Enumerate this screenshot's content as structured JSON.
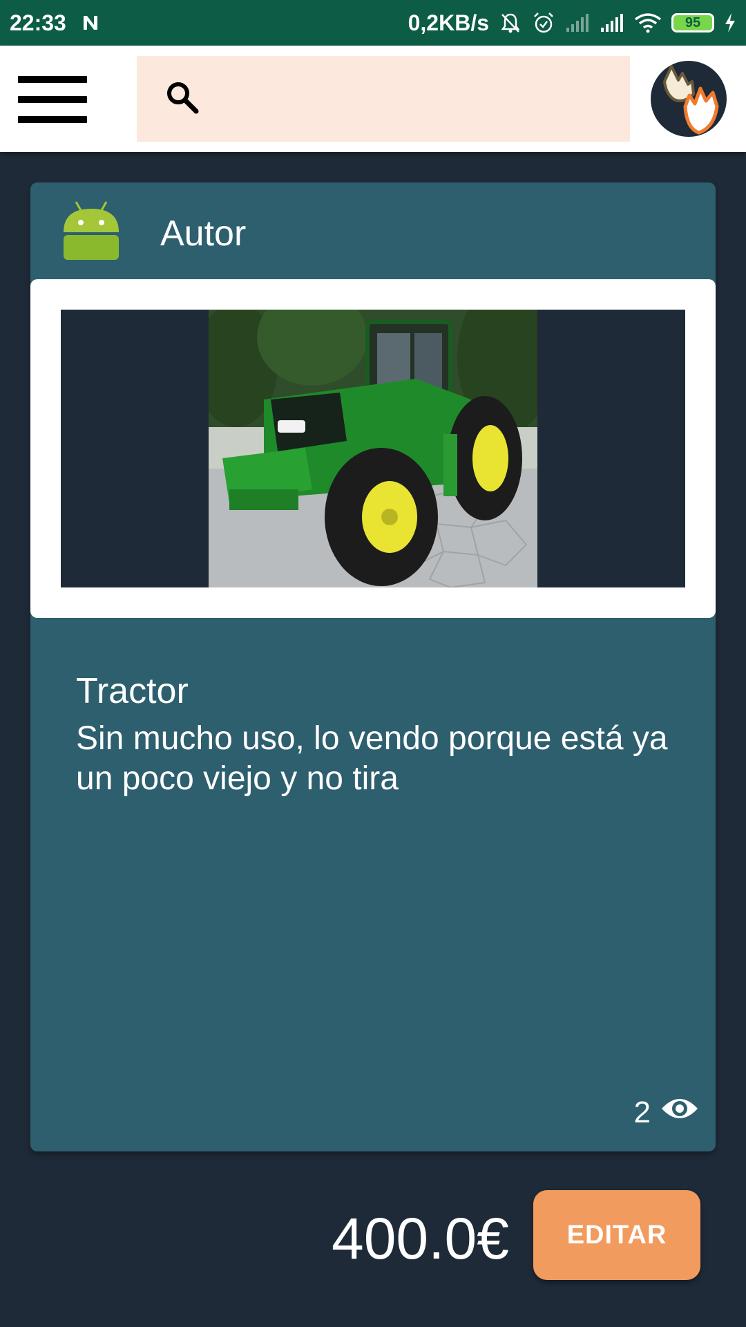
{
  "status_bar": {
    "time": "22:33",
    "speed": "0,2KB/s",
    "battery": "95",
    "icons": [
      "n-notification-icon",
      "mute-bell-icon",
      "alarm-icon",
      "signal-icon",
      "signal-icon",
      "wifi-icon",
      "battery-icon",
      "charging-icon"
    ]
  },
  "app_bar": {
    "menu_icon": "hamburger-menu-icon",
    "search_icon": "search-icon",
    "search_placeholder": "",
    "profile_icon": "hands-logo-icon"
  },
  "product": {
    "author": "Autor",
    "author_icon": "android-icon",
    "title": "Tractor",
    "description": "Sin mucho uso, lo vendo porque está ya un poco viejo y no tira",
    "view_count": "2",
    "view_icon": "eye-icon"
  },
  "footer": {
    "price": "400.0€",
    "edit_button": "EDITAR"
  },
  "colors": {
    "status_bar": "#0d5c46",
    "background": "#1f2a38",
    "card": "#2e5f6e",
    "search_bg": "#fce8dc",
    "accent": "#f29b5e"
  }
}
